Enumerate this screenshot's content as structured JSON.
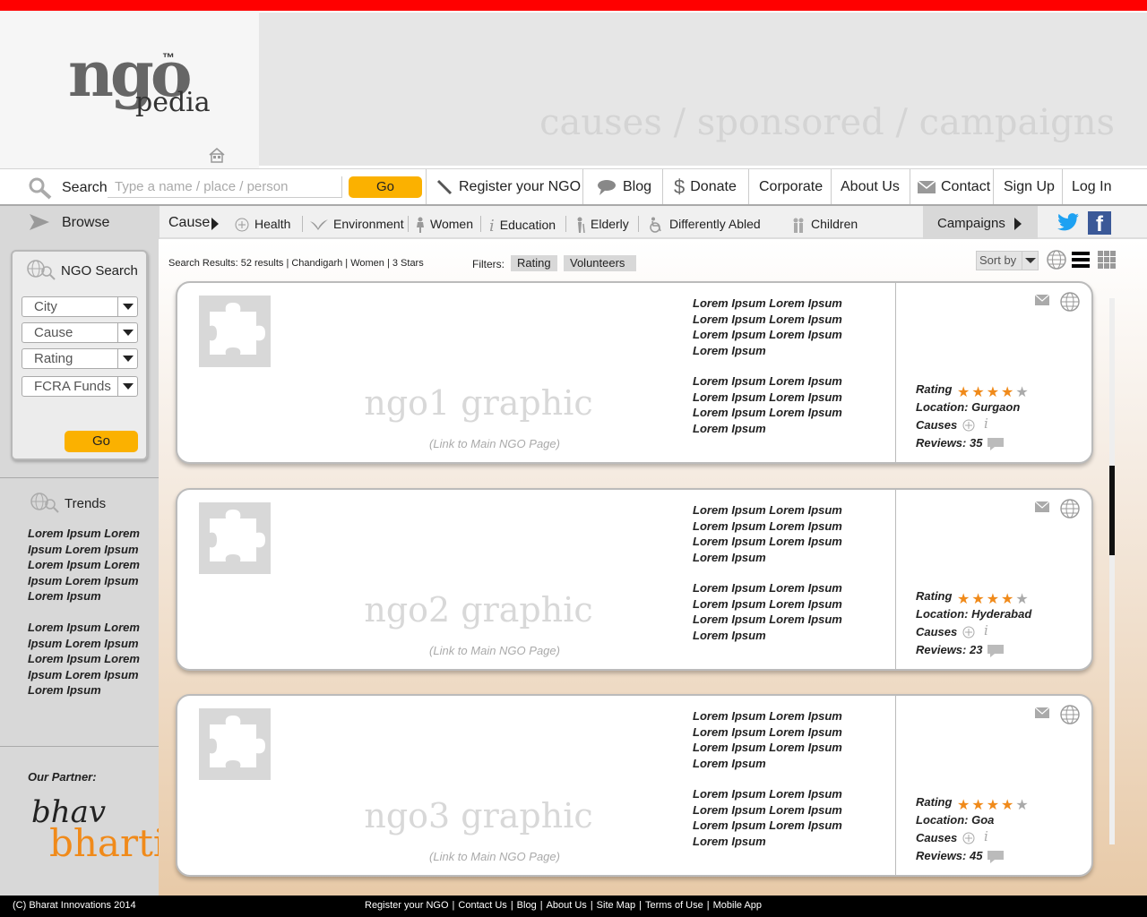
{
  "brand": {
    "logo_ngo": "ngo",
    "logo_tm": "™",
    "logo_pedia": "pedia"
  },
  "banner": {
    "tagline": "causes / sponsored / campaigns"
  },
  "nav": {
    "search_label": "Search",
    "search_placeholder": "Type a name / place / person",
    "go": "Go",
    "items": [
      "Register your NGO",
      "Blog",
      "Donate",
      "Corporate",
      "About Us",
      "Contact",
      "Sign Up",
      "Log In"
    ]
  },
  "categories": {
    "browse": "Browse",
    "cause": "Cause",
    "items": [
      "Health",
      "Environment",
      "Women",
      "Education",
      "Elderly",
      "Differently Abled",
      "Children"
    ],
    "campaigns": "Campaigns"
  },
  "sidebar": {
    "ngo_search_title": "NGO Search",
    "selects": [
      "City",
      "Cause",
      "Rating",
      "FCRA Funds"
    ],
    "go": "Go",
    "trends_title": "Trends",
    "trends": [
      "Lorem Ipsum Lorem Ipsum Lorem Ipsum Lorem Ipsum Lorem Ipsum Lorem Ipsum Lorem Ipsum",
      "Lorem Ipsum Lorem Ipsum Lorem Ipsum Lorem Ipsum Lorem Ipsum Lorem Ipsum Lorem Ipsum"
    ],
    "partner_label": "Our Partner:",
    "partner_bhav": "bhav",
    "partner_bharti": "bharti"
  },
  "results": {
    "summary": "Search Results: 52 results | Chandigarh | Women | 3 Stars",
    "filters_label": "Filters:",
    "filters": [
      "Rating",
      "Volunteers"
    ],
    "sort_by": "Sort by"
  },
  "cards": [
    {
      "graphic": "ngo1 graphic",
      "link": "(Link to Main NGO Page)",
      "text1": "Lorem Ipsum Lorem Ipsum Lorem Ipsum Lorem Ipsum Lorem Ipsum Lorem Ipsum Lorem Ipsum",
      "text2": "Lorem Ipsum Lorem Ipsum Lorem Ipsum Lorem Ipsum Lorem Ipsum Lorem Ipsum Lorem Ipsum",
      "rating_label": "Rating",
      "rating": 4,
      "location": "Location: Gurgaon",
      "causes": "Causes",
      "reviews": "Reviews: 35"
    },
    {
      "graphic": "ngo2 graphic",
      "link": "(Link to Main NGO Page)",
      "text1": "Lorem Ipsum Lorem Ipsum Lorem Ipsum Lorem Ipsum Lorem Ipsum Lorem Ipsum Lorem Ipsum",
      "text2": "Lorem Ipsum Lorem Ipsum Lorem Ipsum Lorem Ipsum Lorem Ipsum Lorem Ipsum Lorem Ipsum",
      "rating_label": "Rating",
      "rating": 4,
      "location": "Location: Hyderabad",
      "causes": "Causes",
      "reviews": "Reviews: 23"
    },
    {
      "graphic": "ngo3 graphic",
      "link": "(Link to Main NGO Page)",
      "text1": "Lorem Ipsum Lorem Ipsum Lorem Ipsum Lorem Ipsum Lorem Ipsum Lorem Ipsum Lorem Ipsum",
      "text2": "Lorem Ipsum Lorem Ipsum Lorem Ipsum Lorem Ipsum Lorem Ipsum Lorem Ipsum Lorem Ipsum",
      "rating_label": "Rating",
      "rating": 4,
      "location": "Location: Goa",
      "causes": "Causes",
      "reviews": "Reviews: 45"
    }
  ],
  "footer": {
    "copyright": "(C) Bharat Innovations 2014",
    "links": [
      "Register your NGO",
      "Contact Us",
      "Blog",
      "About Us",
      "Site Map",
      "Terms of Use",
      "Mobile App"
    ]
  },
  "colors": {
    "accent_red": "#ff0000",
    "go_button": "#fbb100",
    "star": "#f08a1a",
    "partner_orange": "#f08a1a"
  }
}
